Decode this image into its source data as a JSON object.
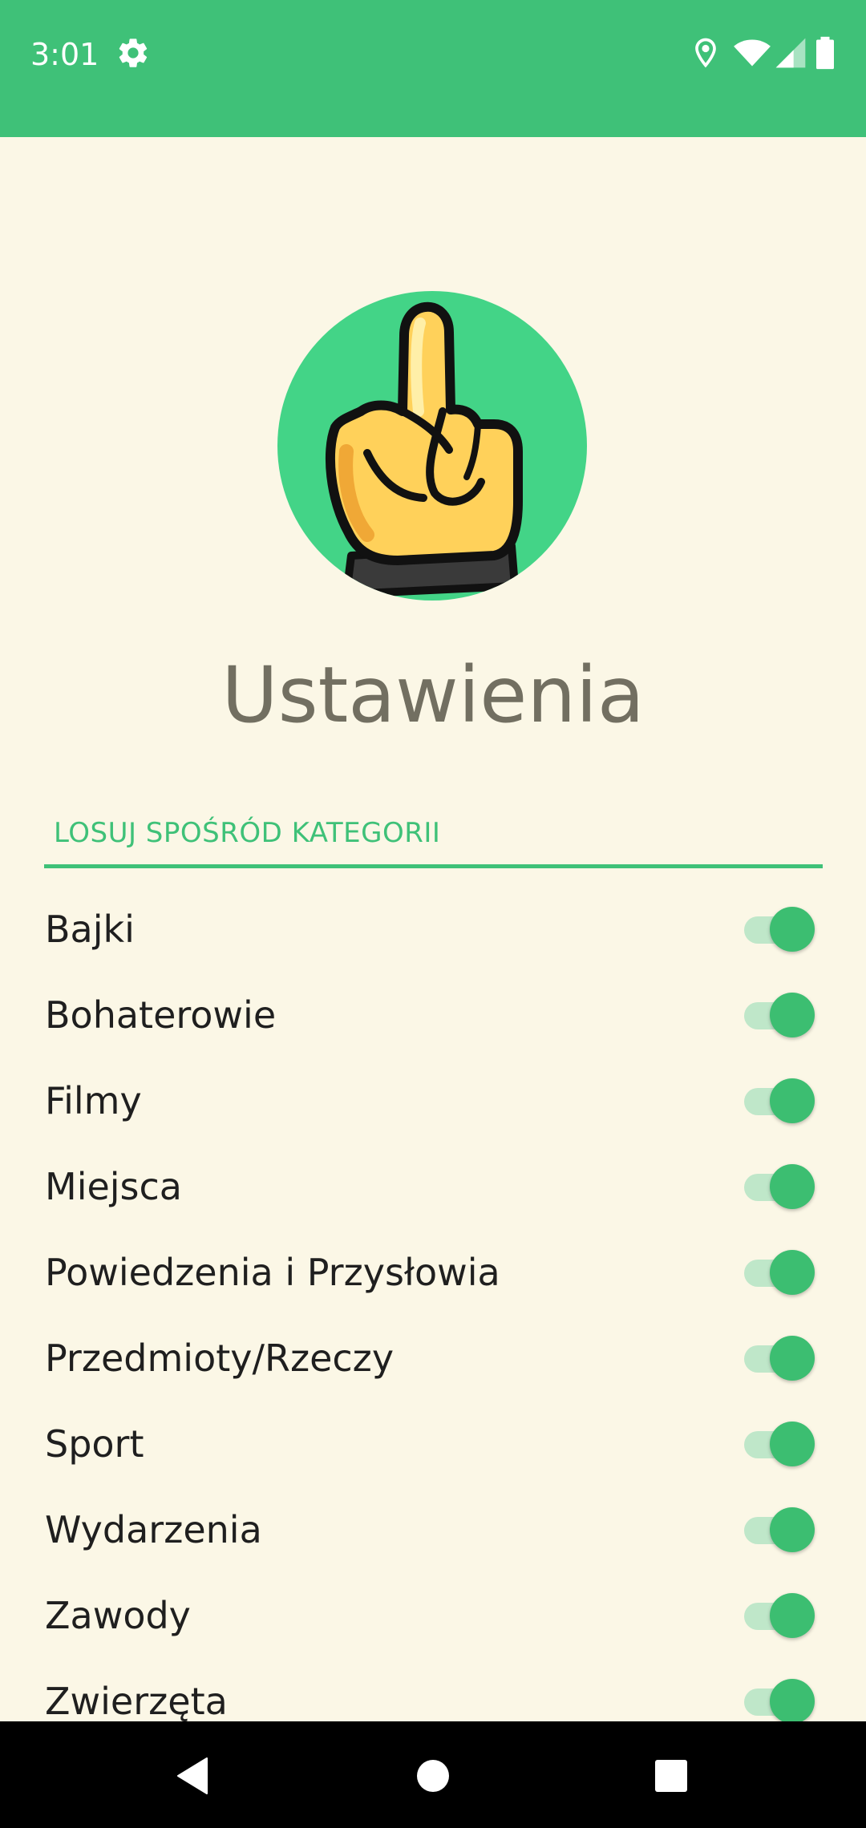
{
  "status_bar": {
    "time": "3:01",
    "icons": [
      "settings-icon",
      "location-icon",
      "wifi-icon",
      "signal-icon",
      "battery-icon"
    ]
  },
  "header": {
    "title": "Ustawienia",
    "logo": "hand-finger-logo"
  },
  "section": {
    "title": "LOSUJ SPOŚRÓD KATEGORII"
  },
  "categories": [
    {
      "label": "Bajki",
      "enabled": true
    },
    {
      "label": "Bohaterowie",
      "enabled": true
    },
    {
      "label": "Filmy",
      "enabled": true
    },
    {
      "label": "Miejsca",
      "enabled": true
    },
    {
      "label": "Powiedzenia i Przysłowia",
      "enabled": true
    },
    {
      "label": "Przedmioty/Rzeczy",
      "enabled": true
    },
    {
      "label": "Sport",
      "enabled": true
    },
    {
      "label": "Wydarzenia",
      "enabled": true
    },
    {
      "label": "Zawody",
      "enabled": true
    },
    {
      "label": "Zwierzęta",
      "enabled": true
    }
  ],
  "colors": {
    "accent": "#3FC178",
    "background": "#FBF7E6",
    "title": "#726F61",
    "toggle_track": "#BFE7C9",
    "toggle_thumb": "#3CBE71"
  },
  "nav_bar": {
    "icons": [
      "back-icon",
      "home-icon",
      "recents-icon"
    ]
  }
}
